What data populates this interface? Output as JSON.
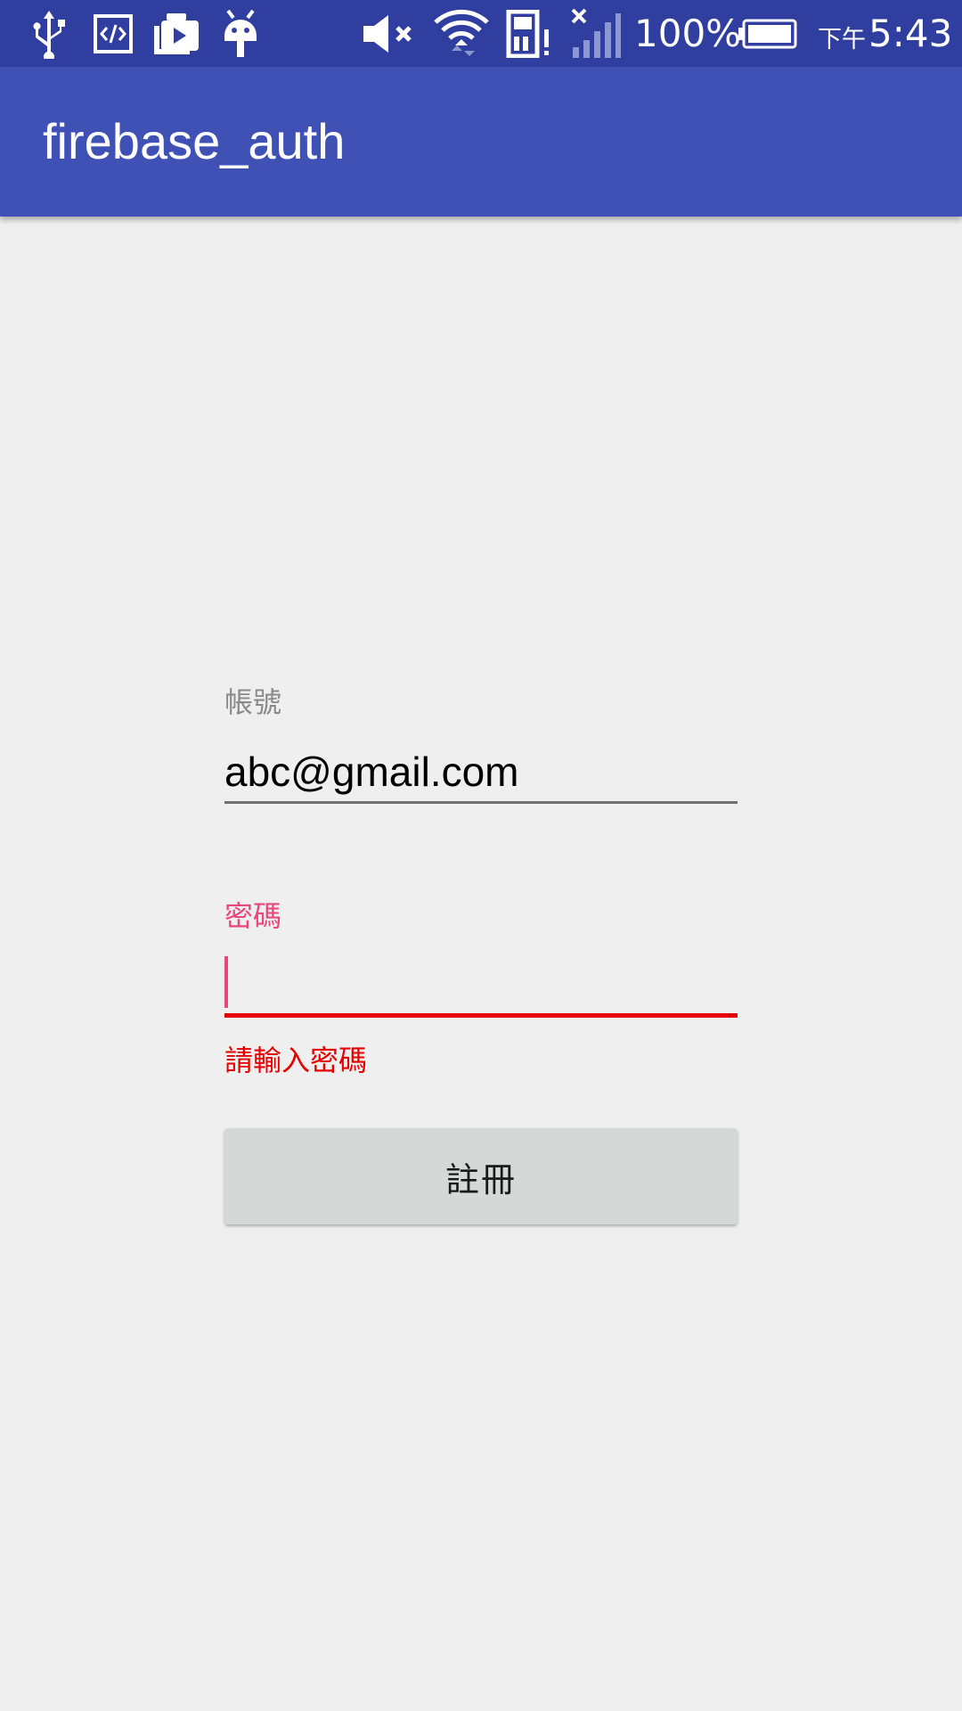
{
  "status_bar": {
    "icons_left": [
      "usb-icon",
      "developer-code-icon",
      "screen-cast-icon",
      "android-debug-icon"
    ],
    "icons_right": [
      "volume-muted-icon",
      "wifi-icon",
      "sd-card-alert-icon",
      "signal-no-service-icon",
      "battery-icon"
    ],
    "battery_percent": "100%",
    "clock_prefix": "下午",
    "clock_time": "5:43",
    "background_color": "#303f9f"
  },
  "app_bar": {
    "title": "firebase_auth",
    "background_color": "#3f51b5"
  },
  "form": {
    "account": {
      "label": "帳號",
      "value": "abc@gmail.com"
    },
    "password": {
      "label": "密碼",
      "value": "",
      "error": "請輸入密碼",
      "accent_color": "#e8467c",
      "error_color": "#e60000"
    },
    "register_button": {
      "label": "註冊"
    }
  }
}
